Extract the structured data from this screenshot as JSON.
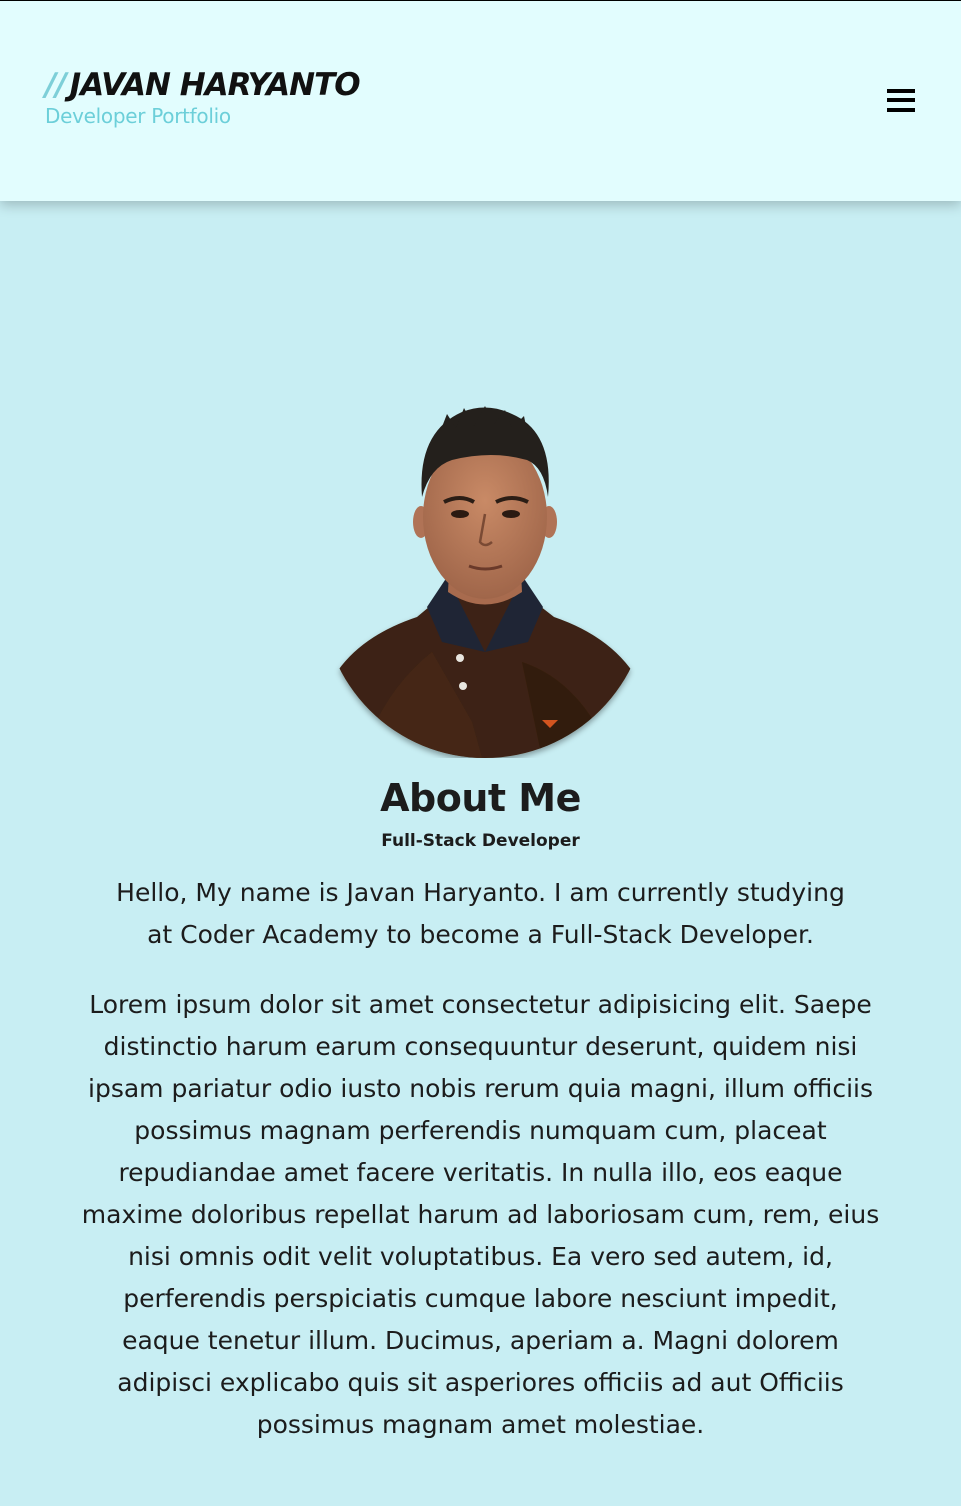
{
  "header": {
    "brand_slashes": "//",
    "brand_name": "JAVAN HARYANTO",
    "brand_subtitle": "Developer Portfolio",
    "menu_icon": "hamburger-menu-icon"
  },
  "about": {
    "avatar_alt": "Portrait of Javan Haryanto",
    "title": "About Me",
    "role": "Full-Stack Developer",
    "intro": "Hello, My name is Javan Haryanto. I am currently studying at Coder Academy to become a Full-Stack Developer.",
    "body": "Lorem ipsum dolor sit amet consectetur adipisicing elit. Saepe distinctio harum earum consequuntur deserunt, quidem nisi ipsam pariatur odio iusto nobis rerum quia magni, illum officiis possimus magnam perferendis numquam cum, placeat repudiandae amet facere veritatis. In nulla illo, eos eaque maxime doloribus repellat harum ad laboriosam cum, rem, eius nisi omnis odit velit voluptatibus. Ea vero sed autem, id, perferendis perspiciatis cumque labore nesciunt impedit, eaque tenetur illum. Ducimus, aperiam a. Magni dolorem adipisci explicabo quis sit asperiores officiis ad aut Officiis possimus magnam amet molestiae."
  },
  "colors": {
    "header_bg": "#e2fdfe",
    "page_bg": "#c8eef3",
    "accent": "#6ccfd9",
    "text": "#1c1c1c"
  }
}
